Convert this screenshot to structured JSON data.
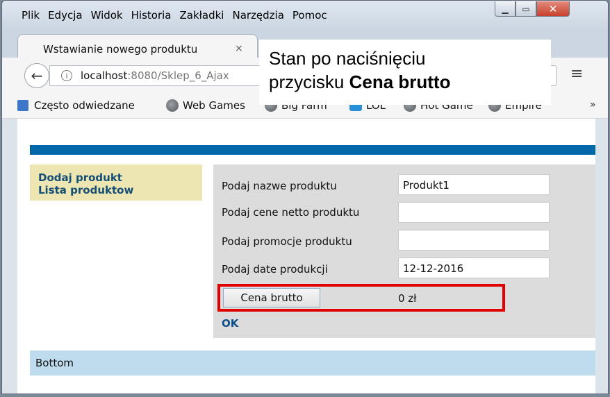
{
  "menu": {
    "items": [
      {
        "label": "Plik"
      },
      {
        "label": "Edycja"
      },
      {
        "label": "Widok"
      },
      {
        "label": "Historia"
      },
      {
        "label": "Zakładki"
      },
      {
        "label": "Narzędzia"
      },
      {
        "label": "Pomoc"
      }
    ]
  },
  "tab": {
    "title": "Wstawianie nowego produktu",
    "close": "×"
  },
  "url": {
    "host": "localhost",
    "rest": ":8080/Sklep_6_Ajax"
  },
  "bookmarks": {
    "items": [
      {
        "label": "Często odwiedzane"
      },
      {
        "label": "Web Games"
      },
      {
        "label": "Big Farm"
      },
      {
        "label": "LOL"
      },
      {
        "label": "Hot Game"
      },
      {
        "label": "Empire"
      }
    ],
    "more": "»"
  },
  "sidebar": {
    "items": [
      {
        "label": "Dodaj produkt"
      },
      {
        "label": "Lista produktow"
      }
    ]
  },
  "form": {
    "rows": [
      {
        "label": "Podaj nazwe produktu",
        "value": "Produkt1"
      },
      {
        "label": "Podaj cene netto produktu",
        "value": ""
      },
      {
        "label": "Podaj promocje produktu",
        "value": ""
      },
      {
        "label": "Podaj date produkcji",
        "value": "12-12-2016"
      }
    ],
    "button": "Cena brutto",
    "price": "0 zł",
    "ok": "OK"
  },
  "footer": {
    "label": "Bottom"
  },
  "overlay": {
    "line1": "Stan po naciśnięciu",
    "line2_prefix": "przycisku ",
    "line2_bold": "Cena brutto"
  }
}
